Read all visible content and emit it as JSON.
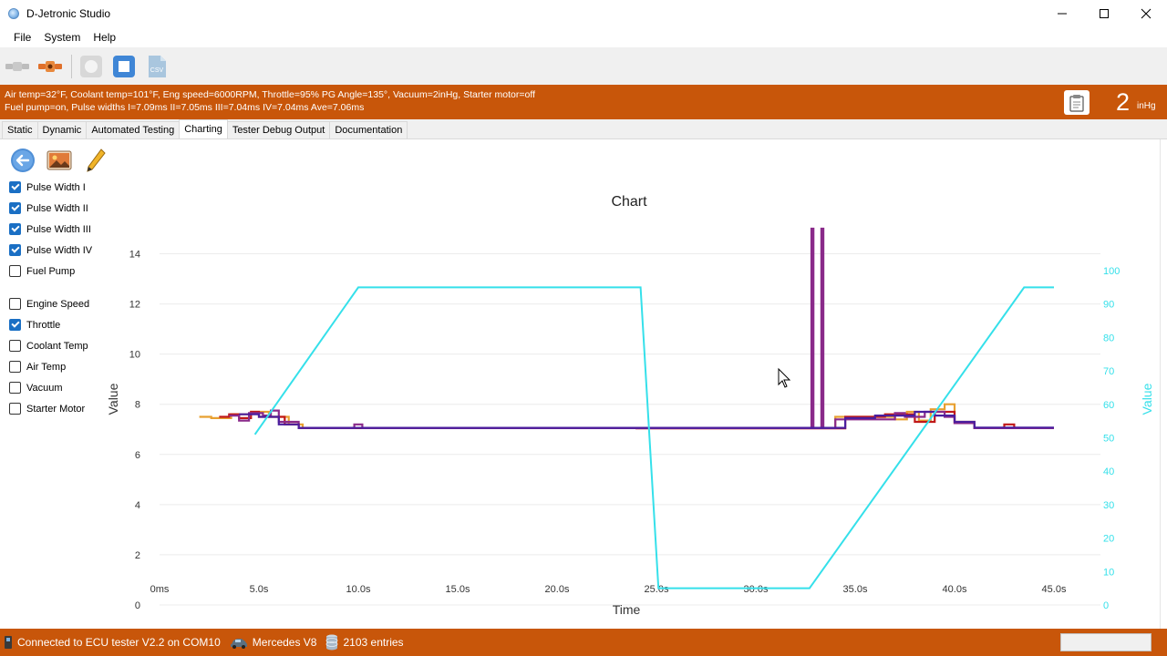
{
  "window": {
    "title": "D-Jetronic Studio",
    "minimize": "—",
    "maximize": "☐",
    "close": "✕"
  },
  "menu": [
    "File",
    "System",
    "Help"
  ],
  "toolbar": {
    "csv_label": "CSV"
  },
  "status": {
    "line1": "Air temp=32°F, Coolant temp=101°F, Eng speed=6000RPM, Throttle=95% PG Angle=135°, Vacuum=2inHg, Starter motor=off",
    "line2": "Fuel pump=on, Pulse widths I=7.09ms II=7.05ms III=7.04ms IV=7.04ms Ave=7.06ms",
    "vacuum_value": "2",
    "vacuum_unit": "inHg"
  },
  "tabs": [
    {
      "label": "Static",
      "active": false
    },
    {
      "label": "Dynamic",
      "active": false
    },
    {
      "label": "Automated Testing",
      "active": false
    },
    {
      "label": "Charting",
      "active": true
    },
    {
      "label": "Tester Debug Output",
      "active": false
    },
    {
      "label": "Documentation",
      "active": false
    }
  ],
  "series_toggles": [
    {
      "label": "Pulse Width I",
      "checked": true
    },
    {
      "label": "Pulse Width II",
      "checked": true
    },
    {
      "label": "Pulse Width III",
      "checked": true
    },
    {
      "label": "Pulse Width IV",
      "checked": true
    },
    {
      "label": "Fuel Pump",
      "checked": false
    },
    {
      "label": "Engine Speed",
      "checked": false
    },
    {
      "label": "Throttle",
      "checked": true
    },
    {
      "label": "Coolant Temp",
      "checked": false
    },
    {
      "label": "Air Temp",
      "checked": false
    },
    {
      "label": "Vacuum",
      "checked": false
    },
    {
      "label": "Starter Motor",
      "checked": false
    }
  ],
  "statusbar": {
    "connection": "Connected to ECU tester V2.2 on COM10",
    "engine": "Mercedes V8",
    "entries": "2103 entries"
  },
  "colors": {
    "orange": "#c8560a",
    "pw1": "#c01818",
    "pw2": "#e8a030",
    "pw3": "#8a2a8a",
    "pw4": "#4b1e9e",
    "throttle": "#35e0ea",
    "check": "#1a6fc4"
  },
  "chart_data": {
    "type": "line",
    "title": "Chart",
    "xlabel": "Time",
    "ylabel": "Value",
    "y2label": "Value",
    "xlim": [
      0,
      45
    ],
    "ylim": [
      0,
      15
    ],
    "y2lim": [
      0,
      100
    ],
    "xticks": [
      {
        "v": 0,
        "label": "0ms"
      },
      {
        "v": 5,
        "label": "5.0s"
      },
      {
        "v": 10,
        "label": "10.0s"
      },
      {
        "v": 15,
        "label": "15.0s"
      },
      {
        "v": 20,
        "label": "20.0s"
      },
      {
        "v": 25,
        "label": "25.0s"
      },
      {
        "v": 30,
        "label": "30.0s"
      },
      {
        "v": 35,
        "label": "35.0s"
      },
      {
        "v": 40,
        "label": "40.0s"
      },
      {
        "v": 45,
        "label": "45.0s"
      }
    ],
    "yticks": [
      0,
      2,
      4,
      6,
      8,
      10,
      12,
      14
    ],
    "y2ticks": [
      0,
      10,
      20,
      30,
      40,
      50,
      60,
      70,
      80,
      90,
      100
    ],
    "grid": "horizontal",
    "series": [
      {
        "axis": "left",
        "color_key": "pw2",
        "points": [
          [
            2.0,
            7.5
          ],
          [
            2.6,
            7.5
          ],
          [
            2.6,
            7.45
          ],
          [
            3.6,
            7.45
          ],
          [
            3.6,
            7.6
          ],
          [
            4.6,
            7.6
          ],
          [
            4.6,
            7.7
          ],
          [
            5.5,
            7.7
          ],
          [
            5.5,
            7.5
          ],
          [
            6.5,
            7.5
          ],
          [
            6.5,
            7.2
          ],
          [
            7.2,
            7.2
          ],
          [
            7.2,
            7.05
          ],
          [
            24.0,
            7.05
          ],
          [
            24.0,
            7.06
          ],
          [
            34.0,
            7.06
          ],
          [
            34.0,
            7.5
          ],
          [
            37.0,
            7.5
          ],
          [
            37.0,
            7.4
          ],
          [
            37.6,
            7.4
          ],
          [
            37.6,
            7.7
          ],
          [
            38.2,
            7.7
          ],
          [
            38.2,
            7.35
          ],
          [
            38.8,
            7.35
          ],
          [
            38.8,
            7.8
          ],
          [
            39.5,
            7.8
          ],
          [
            39.5,
            8.0
          ],
          [
            40.0,
            8.0
          ],
          [
            40.0,
            7.3
          ],
          [
            41.0,
            7.3
          ],
          [
            41.0,
            7.05
          ],
          [
            45.0,
            7.05
          ]
        ]
      },
      {
        "axis": "left",
        "color_key": "pw1",
        "points": [
          [
            3.0,
            7.5
          ],
          [
            3.5,
            7.5
          ],
          [
            3.5,
            7.6
          ],
          [
            4.0,
            7.6
          ],
          [
            4.0,
            7.45
          ],
          [
            4.6,
            7.45
          ],
          [
            4.6,
            7.7
          ],
          [
            5.0,
            7.7
          ],
          [
            5.0,
            7.5
          ],
          [
            6.3,
            7.5
          ],
          [
            6.3,
            7.2
          ],
          [
            7.0,
            7.2
          ],
          [
            7.0,
            7.05
          ],
          [
            24.0,
            7.05
          ],
          [
            24.0,
            7.04
          ],
          [
            34.5,
            7.04
          ],
          [
            34.5,
            7.5
          ],
          [
            36.5,
            7.5
          ],
          [
            36.5,
            7.6
          ],
          [
            38.0,
            7.6
          ],
          [
            38.0,
            7.3
          ],
          [
            39.0,
            7.3
          ],
          [
            39.0,
            7.7
          ],
          [
            40.0,
            7.7
          ],
          [
            40.0,
            7.25
          ],
          [
            41.0,
            7.25
          ],
          [
            41.0,
            7.05
          ],
          [
            42.5,
            7.05
          ],
          [
            42.5,
            7.2
          ],
          [
            43.0,
            7.2
          ],
          [
            43.0,
            7.05
          ],
          [
            45.0,
            7.05
          ]
        ]
      },
      {
        "axis": "left",
        "color_key": "pw3",
        "points": [
          [
            3.5,
            7.55
          ],
          [
            4.0,
            7.55
          ],
          [
            4.0,
            7.35
          ],
          [
            4.5,
            7.35
          ],
          [
            4.5,
            7.65
          ],
          [
            5.2,
            7.65
          ],
          [
            5.2,
            7.55
          ],
          [
            5.6,
            7.55
          ],
          [
            5.6,
            7.75
          ],
          [
            6.0,
            7.75
          ],
          [
            6.0,
            7.3
          ],
          [
            7.0,
            7.3
          ],
          [
            7.0,
            7.05
          ],
          [
            9.8,
            7.05
          ],
          [
            9.8,
            7.2
          ],
          [
            10.2,
            7.2
          ],
          [
            10.2,
            7.05
          ],
          [
            32.8,
            7.05
          ],
          [
            32.8,
            15.0
          ],
          [
            32.9,
            15.0
          ],
          [
            32.9,
            7.05
          ],
          [
            33.3,
            7.05
          ],
          [
            33.3,
            15.0
          ],
          [
            33.4,
            15.0
          ],
          [
            33.4,
            7.05
          ],
          [
            34.0,
            7.05
          ],
          [
            34.0,
            7.4
          ],
          [
            37.0,
            7.4
          ],
          [
            37.0,
            7.65
          ],
          [
            37.5,
            7.65
          ],
          [
            37.5,
            7.5
          ],
          [
            38.5,
            7.5
          ],
          [
            38.5,
            7.7
          ],
          [
            39.5,
            7.7
          ],
          [
            39.5,
            7.5
          ],
          [
            40.0,
            7.5
          ],
          [
            40.0,
            7.25
          ],
          [
            41.0,
            7.25
          ],
          [
            41.0,
            7.05
          ],
          [
            45.0,
            7.05
          ]
        ]
      },
      {
        "axis": "left",
        "color_key": "pw4",
        "points": [
          [
            4.0,
            7.6
          ],
          [
            5.0,
            7.6
          ],
          [
            5.0,
            7.5
          ],
          [
            6.0,
            7.5
          ],
          [
            6.0,
            7.2
          ],
          [
            7.0,
            7.2
          ],
          [
            7.0,
            7.06
          ],
          [
            34.5,
            7.06
          ],
          [
            34.5,
            7.45
          ],
          [
            36.0,
            7.45
          ],
          [
            36.0,
            7.55
          ],
          [
            38.0,
            7.55
          ],
          [
            38.0,
            7.7
          ],
          [
            39.0,
            7.7
          ],
          [
            39.0,
            7.55
          ],
          [
            40.0,
            7.55
          ],
          [
            40.0,
            7.3
          ],
          [
            41.0,
            7.3
          ],
          [
            41.0,
            7.07
          ],
          [
            45.0,
            7.07
          ]
        ]
      },
      {
        "axis": "right",
        "color_key": "throttle",
        "points": [
          [
            4.8,
            51
          ],
          [
            10.0,
            95
          ],
          [
            24.2,
            95
          ],
          [
            25.1,
            5
          ],
          [
            32.7,
            5
          ],
          [
            43.5,
            95
          ],
          [
            45.0,
            95
          ]
        ]
      }
    ]
  }
}
